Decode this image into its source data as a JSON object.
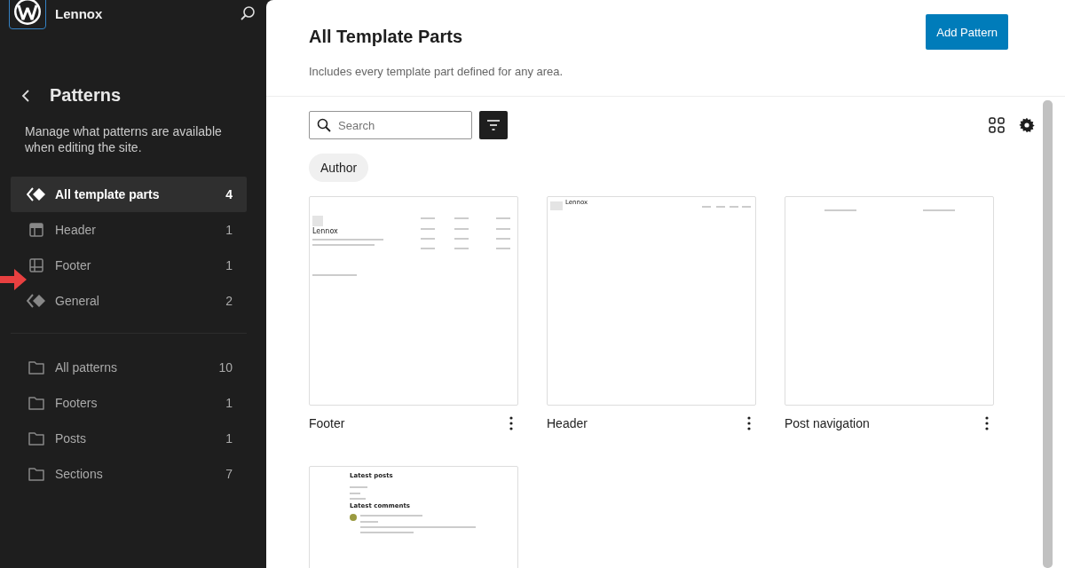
{
  "site": {
    "name": "Lennox"
  },
  "nav": {
    "title": "Patterns",
    "description": "Manage what patterns are available when editing the site."
  },
  "sidebar_items": [
    {
      "label": "All template parts",
      "count": "4",
      "kind": "template",
      "selected": true
    },
    {
      "label": "Header",
      "count": "1",
      "kind": "header",
      "selected": false
    },
    {
      "label": "Footer",
      "count": "1",
      "kind": "footer",
      "selected": false
    },
    {
      "label": "General",
      "count": "2",
      "kind": "template",
      "selected": false
    }
  ],
  "categories": [
    {
      "label": "All patterns",
      "count": "10",
      "selected": false
    },
    {
      "label": "Footers",
      "count": "1",
      "selected": false
    },
    {
      "label": "Posts",
      "count": "1",
      "selected": false
    },
    {
      "label": "Sections",
      "count": "7",
      "selected": false
    }
  ],
  "annotation_arrow": true,
  "page": {
    "title": "All Template Parts",
    "description": "Includes every template part defined for any area.",
    "button": "Add Pattern"
  },
  "search": {
    "placeholder": "Search"
  },
  "filter_chip": "Author",
  "cards": [
    {
      "title": "Footer",
      "kind": "footer",
      "preview_texts": [
        "Lennox"
      ]
    },
    {
      "title": "Header",
      "kind": "header",
      "preview_texts": [
        "Lennox"
      ]
    },
    {
      "title": "Post navigation",
      "kind": "navigation"
    },
    {
      "kind": "posts",
      "preview_texts": [
        "Latest posts",
        "Latest comments"
      ]
    }
  ]
}
